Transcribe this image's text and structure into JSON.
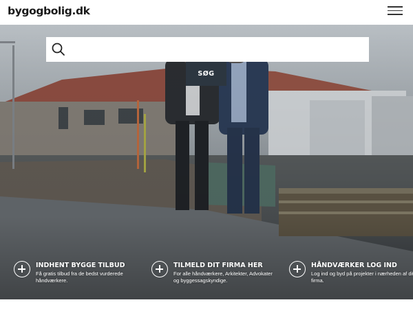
{
  "header": {
    "logo": "bygogbolig.dk",
    "menu_icon": "hamburger-menu-icon"
  },
  "search": {
    "placeholder": "",
    "button_label": "SØG",
    "icon": "search-icon"
  },
  "features": [
    {
      "title": "INDHENT BYGGE TILBUD",
      "description": "Få gratis tilbud fra de bedst vurderede håndværkere.",
      "icon": "plus-circle-icon"
    },
    {
      "title": "TILMELD DIT FIRMA HER",
      "description": "For alle håndværkere, Arkitekter, Advokater og byggessagskyndige.",
      "icon": "plus-circle-icon"
    },
    {
      "title": "HÅNDVÆRKER LOG IND",
      "description": "Log ind og byd på projekter i nærheden af dit firma.",
      "icon": "plus-circle-icon"
    }
  ],
  "colors": {
    "search_button": "#2c3640",
    "header_bg": "#ffffff",
    "feature_text": "#ffffff"
  }
}
